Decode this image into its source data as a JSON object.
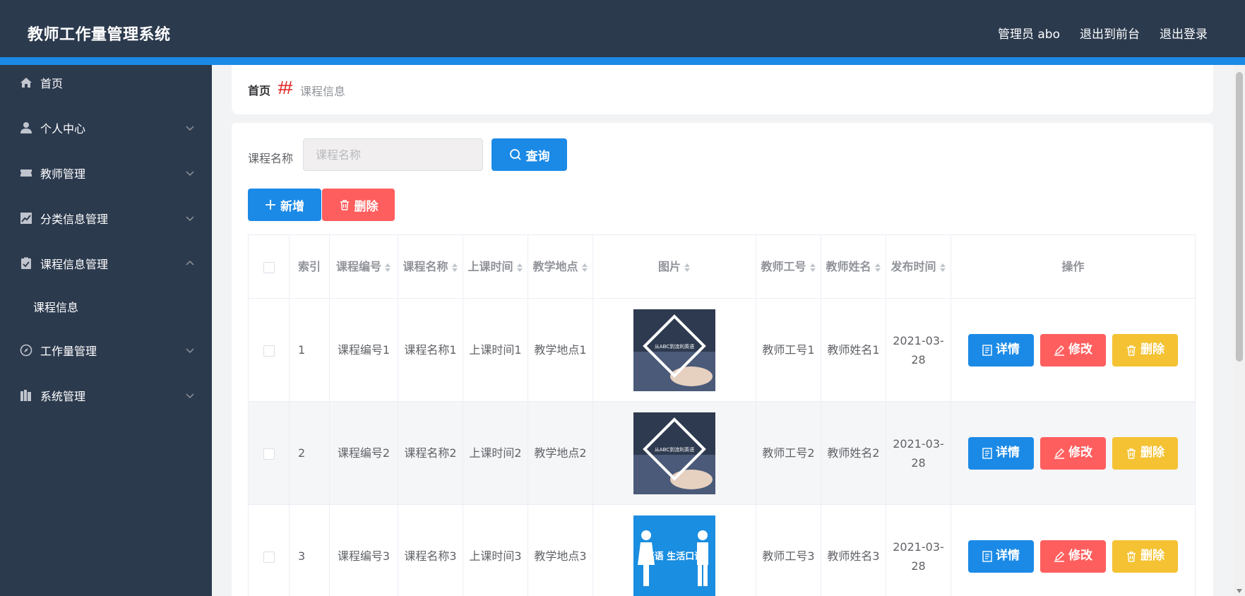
{
  "app": {
    "title": "教师工作量管理系统"
  },
  "topnav": {
    "admin": "管理员 abo",
    "to_front": "退出到前台",
    "logout": "退出登录"
  },
  "sidebar": {
    "items": [
      {
        "label": "首页",
        "icon": "home-icon"
      },
      {
        "label": "个人中心",
        "icon": "user-icon"
      },
      {
        "label": "教师管理",
        "icon": "ticket-icon"
      },
      {
        "label": "分类信息管理",
        "icon": "chart-icon"
      },
      {
        "label": "课程信息管理",
        "icon": "clipboard-icon"
      },
      {
        "label": "课程信息"
      },
      {
        "label": "工作量管理",
        "icon": "compass-icon"
      },
      {
        "label": "系统管理",
        "icon": "books-icon"
      }
    ]
  },
  "breadcrumb": {
    "home": "首页",
    "current": "课程信息"
  },
  "search": {
    "label": "课程名称",
    "placeholder": "课程名称",
    "value": "",
    "query_button": "查询"
  },
  "actions": {
    "add": "新增",
    "delete": "删除"
  },
  "table": {
    "headers": [
      "索引",
      "课程编号",
      "课程名称",
      "上课时间",
      "教学地点",
      "图片",
      "教师工号",
      "教师姓名",
      "发布时间",
      "操作"
    ],
    "rows": [
      {
        "index": "1",
        "course_no": "课程编号1",
        "course_name": "课程名称1",
        "time": "上课时间1",
        "place": "教学地点1",
        "image_text": "从ABC到流利英语",
        "teacher_no": "教师工号1",
        "teacher_name": "教师姓名1",
        "published": "2021-03-28"
      },
      {
        "index": "2",
        "course_no": "课程编号2",
        "course_name": "课程名称2",
        "time": "上课时间2",
        "place": "教学地点2",
        "image_text": "从ABC到流利英语",
        "teacher_no": "教师工号2",
        "teacher_name": "教师姓名2",
        "published": "2021-03-28"
      },
      {
        "index": "3",
        "course_no": "课程编号3",
        "course_name": "课程名称3",
        "time": "上课时间3",
        "place": "教学地点3",
        "image_text": "英语 生活口语",
        "teacher_no": "教师工号3",
        "teacher_name": "教师姓名3",
        "published": "2021-03-28"
      }
    ],
    "row_actions": {
      "detail": "详情",
      "edit": "修改",
      "delete": "删除"
    }
  },
  "colors": {
    "header_bg": "#2c3a4e",
    "accent": "#1b8ae6",
    "danger": "#ff5e5e",
    "warning": "#f4c233"
  }
}
